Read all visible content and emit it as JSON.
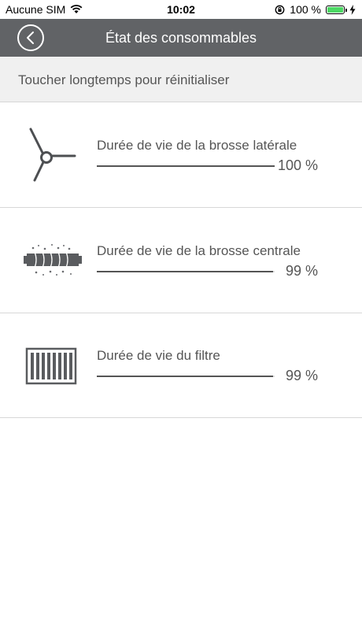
{
  "status_bar": {
    "carrier": "Aucune SIM",
    "time": "10:02",
    "battery": "100 %"
  },
  "header": {
    "title": "État des consommables"
  },
  "hint": "Toucher longtemps pour réinitialiser",
  "consumables": [
    {
      "label": "Durée de vie de la brosse latérale",
      "percent_text": "100 %",
      "value": 100,
      "icon": "side-brush-icon"
    },
    {
      "label": "Durée de vie de la brosse centrale",
      "percent_text": "99 %",
      "value": 99,
      "icon": "main-brush-icon"
    },
    {
      "label": "Durée de vie du filtre",
      "percent_text": "99 %",
      "value": 99,
      "icon": "filter-icon"
    }
  ],
  "colors": {
    "nav_background": "#616366",
    "text": "#555555",
    "battery_fill": "#4cd964"
  }
}
